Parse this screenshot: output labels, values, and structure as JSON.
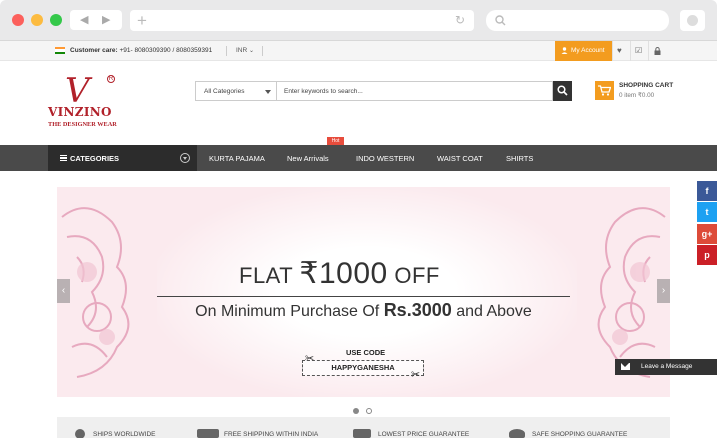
{
  "topbar": {
    "care_label": "Customer care:",
    "care_numbers": "+91- 8080309390 / 8080359391",
    "currency": "INR",
    "account_label": "My Account"
  },
  "brand": {
    "mark": "V",
    "name": "VINZINO",
    "tagline": "THE DESIGNER WEAR",
    "reg": "R",
    "color": "#b1212a"
  },
  "search": {
    "category": "All Categories",
    "placeholder": "Enter keywords to search..."
  },
  "cart": {
    "title": "SHOPPING CART",
    "summary": "0 item ₹0.00"
  },
  "nav": {
    "categories_label": "CATEGORIES",
    "hot_badge": "Hot",
    "items": [
      "KURTA PAJAMA",
      "New Arrivals",
      "INDO WESTERN",
      "WAIST COAT",
      "SHIRTS"
    ]
  },
  "banner": {
    "flat": "FLAT",
    "amount": "₹1000",
    "off": "OFF",
    "line_prefix": "On Minimum Purchase Of",
    "line_amount": "Rs.3000",
    "line_suffix": "and Above",
    "use_code": "USE CODE",
    "code": "HAPPYGANESHA",
    "prev": "‹",
    "next": "›"
  },
  "social": [
    {
      "icon": "facebook-icon",
      "glyph": "f",
      "color": "#3b5998"
    },
    {
      "icon": "twitter-icon",
      "glyph": "t",
      "color": "#1da1f2"
    },
    {
      "icon": "google-plus-icon",
      "glyph": "g+",
      "color": "#dd4b39"
    },
    {
      "icon": "pinterest-icon",
      "glyph": "p",
      "color": "#cb2027"
    }
  ],
  "chat": {
    "label": "Leave a Message"
  },
  "features": [
    "SHIPS WORLDWIDE",
    "FREE SHIPPING WITHIN INDIA",
    "LOWEST PRICE GUARANTEE",
    "SAFE SHOPPING GUARANTEE"
  ],
  "colors": {
    "accent": "#f39c1f",
    "nav": "#4a4a4a",
    "nav_dark": "#2c2c2c"
  }
}
